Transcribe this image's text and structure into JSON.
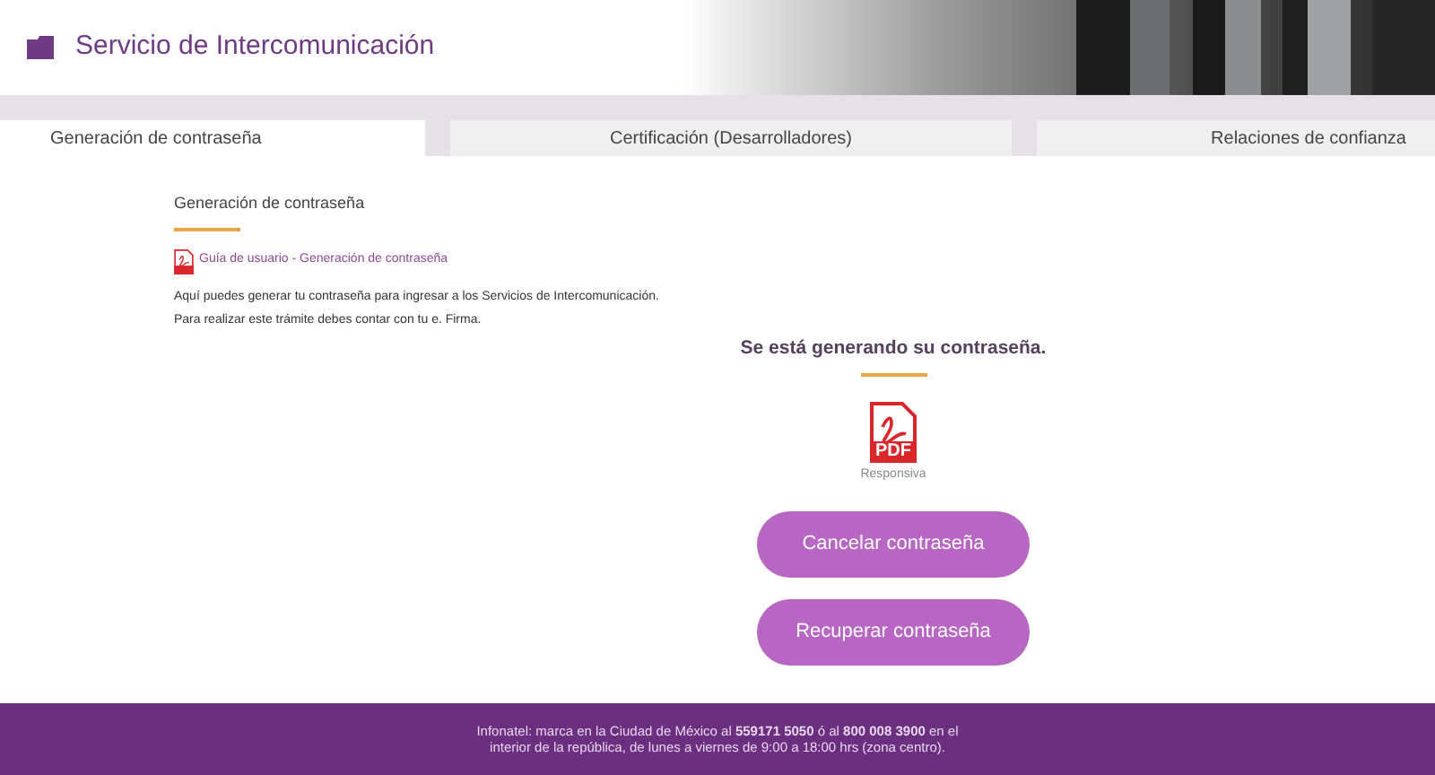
{
  "header": {
    "title": "Servicio de Intercomunicación"
  },
  "tabs": [
    {
      "label": "Generación de contraseña",
      "selected": true
    },
    {
      "label": "Certificación (Desarrolladores)",
      "selected": false
    },
    {
      "label": "Relaciones de confianza",
      "selected": false
    }
  ],
  "section": {
    "title": "Generación de contraseña",
    "guide_link": "Guía de usuario - Generación de contraseña",
    "paragraphs": [
      "Aquí puedes generar tu contraseña para ingresar a los Servicios de Intercomunicación.",
      "Para realizar este trámite debes contar con tu e. Firma."
    ]
  },
  "status": {
    "message": "Se está generando su contraseña.",
    "document": {
      "icon_label": "PDF",
      "caption": "Responsiva"
    }
  },
  "buttons": [
    "Cancelar contraseña",
    "Recuperar contraseña"
  ],
  "footer": "Infonatel: marca en la Ciudad de México al **559171 5050** ó al **800 008 3900** en el interior de la república, de lunes a viernes de 9:00 a 18:00 hrs (zona centro)."
}
